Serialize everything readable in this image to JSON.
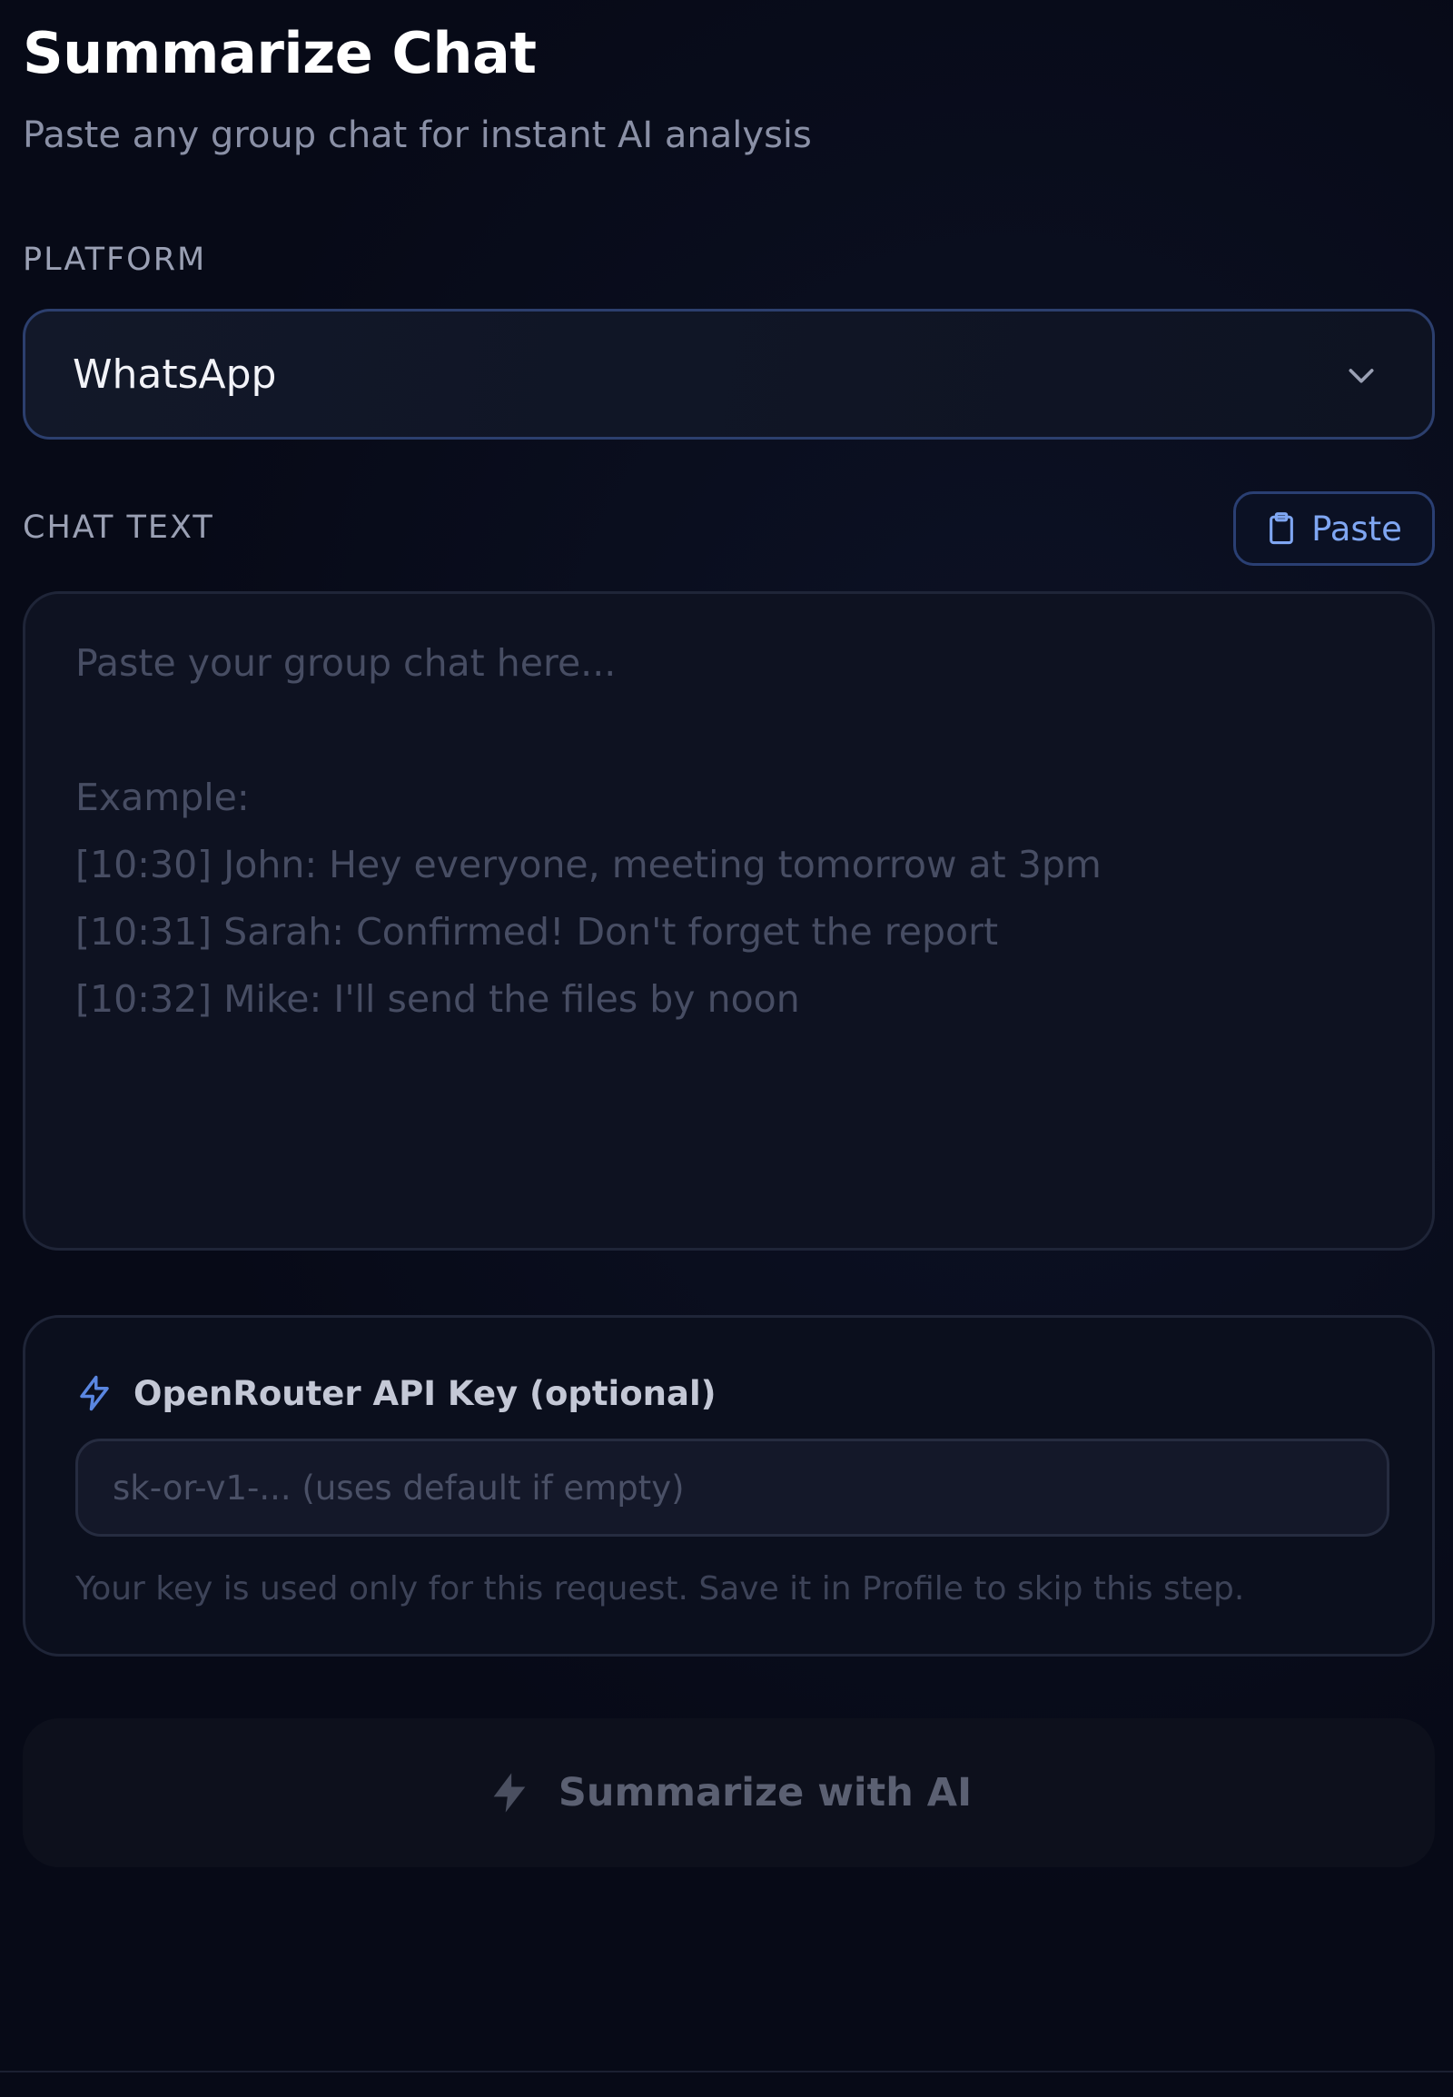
{
  "header": {
    "title": "Summarize Chat",
    "subtitle": "Paste any group chat for instant AI analysis"
  },
  "platform": {
    "label": "PLATFORM",
    "selected": "WhatsApp",
    "icon": "chevron-down-icon"
  },
  "chat_text": {
    "label": "CHAT TEXT",
    "paste_button": {
      "label": "Paste",
      "icon": "clipboard-icon"
    },
    "placeholder_lines": [
      "Paste your group chat here...",
      "",
      "Example:",
      "[10:30] John: Hey everyone, meeting tomorrow at 3pm",
      "[10:31] Sarah: Confirmed! Don't forget the report",
      "[10:32] Mike: I'll send the files by noon"
    ]
  },
  "api_key": {
    "heading": "OpenRouter API Key (optional)",
    "icon": "lightning-icon",
    "placeholder": "sk-or-v1-... (uses default if empty)",
    "value": "",
    "help": "Your key is used only for this request. Save it in Profile to skip this step."
  },
  "summarize_button": {
    "label": "Summarize with AI",
    "icon": "lightning-icon"
  },
  "colors": {
    "background": "#070a17",
    "accent": "#7fa6f2",
    "select_border": "#2c3f6e",
    "button_disabled_text": "#5b6072"
  }
}
